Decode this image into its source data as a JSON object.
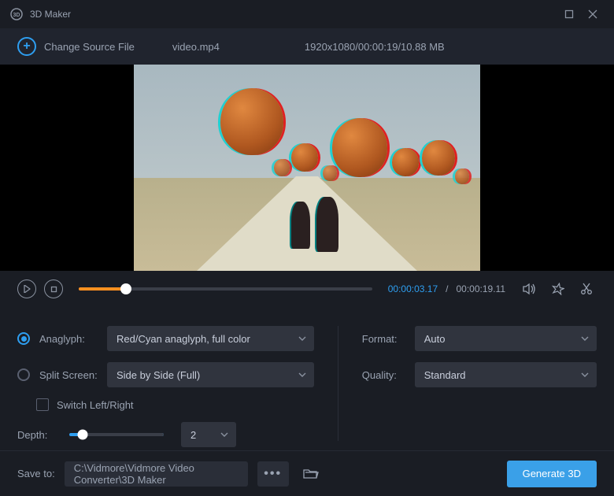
{
  "titlebar": {
    "title": "3D Maker"
  },
  "sourcebar": {
    "change_label": "Change Source File",
    "filename": "video.mp4",
    "meta": "1920x1080/00:00:19/10.88 MB"
  },
  "playbar": {
    "current": "00:00:03.17",
    "sep": "/",
    "total": "00:00:19.11"
  },
  "settings": {
    "anaglyph_label": "Anaglyph:",
    "anaglyph_value": "Red/Cyan anaglyph, full color",
    "split_label": "Split Screen:",
    "split_value": "Side by Side (Full)",
    "switch_label": "Switch Left/Right",
    "depth_label": "Depth:",
    "depth_value": "2",
    "format_label": "Format:",
    "format_value": "Auto",
    "quality_label": "Quality:",
    "quality_value": "Standard"
  },
  "footer": {
    "save_label": "Save to:",
    "save_path": "C:\\Vidmore\\Vidmore Video Converter\\3D Maker",
    "generate_label": "Generate 3D"
  }
}
